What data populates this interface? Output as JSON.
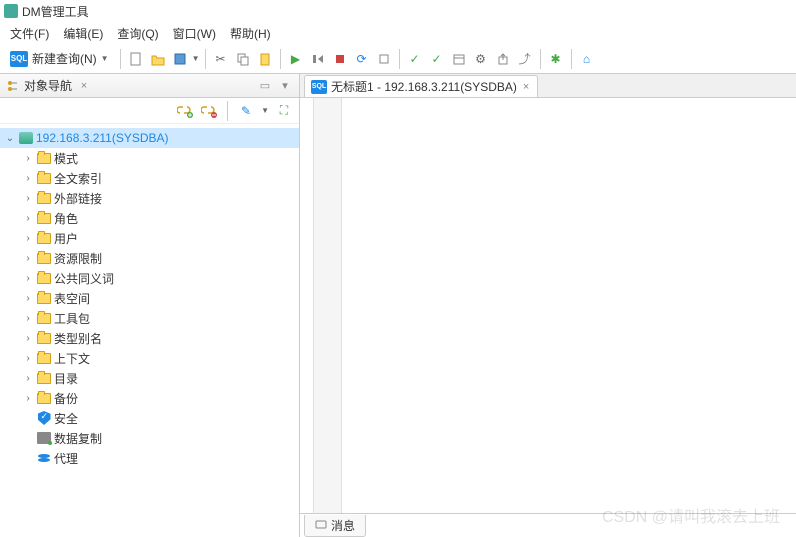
{
  "app_title": "DM管理工具",
  "menu": [
    "文件(F)",
    "编辑(E)",
    "查询(Q)",
    "窗口(W)",
    "帮助(H)"
  ],
  "toolbar": {
    "new_query": "新建查询(N)",
    "icons": [
      "file-icon",
      "folder-icon",
      "disk-icon",
      "cut-icon",
      "copy-icon",
      "paste-icon",
      "play-icon",
      "step-over-icon",
      "stop-icon",
      "refresh-icon",
      "stop-square-icon",
      "check-icon",
      "check-all-icon",
      "calendar-icon",
      "settings-icon",
      "export-icon",
      "up-icon",
      "bug-icon",
      "home-icon"
    ]
  },
  "nav_panel": {
    "title": "对象导航"
  },
  "tree": {
    "root": "192.168.3.211(SYSDBA)",
    "items": [
      {
        "label": "模式",
        "icon": "folder"
      },
      {
        "label": "全文索引",
        "icon": "folder"
      },
      {
        "label": "外部链接",
        "icon": "folder"
      },
      {
        "label": "角色",
        "icon": "folder"
      },
      {
        "label": "用户",
        "icon": "folder"
      },
      {
        "label": "资源限制",
        "icon": "folder"
      },
      {
        "label": "公共同义词",
        "icon": "folder"
      },
      {
        "label": "表空间",
        "icon": "folder"
      },
      {
        "label": "工具包",
        "icon": "folder"
      },
      {
        "label": "类型别名",
        "icon": "folder"
      },
      {
        "label": "上下文",
        "icon": "folder"
      },
      {
        "label": "目录",
        "icon": "folder"
      },
      {
        "label": "备份",
        "icon": "folder"
      },
      {
        "label": "安全",
        "icon": "shield"
      },
      {
        "label": "数据复制",
        "icon": "server"
      },
      {
        "label": "代理",
        "icon": "stack"
      }
    ]
  },
  "editor": {
    "tab_label": "无标题1 - 192.168.3.211(SYSDBA)"
  },
  "bottom": {
    "msg_label": "消息"
  },
  "watermark": "CSDN @请叫我滚去上班"
}
